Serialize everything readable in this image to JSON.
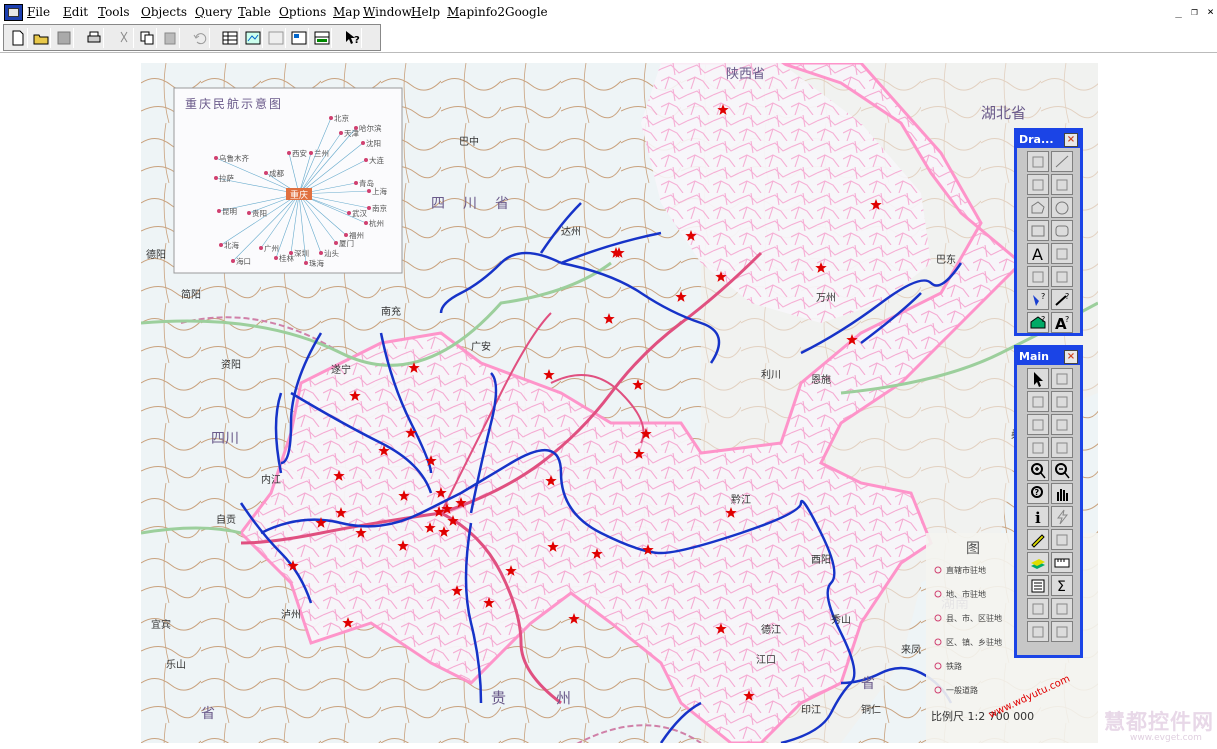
{
  "menu": {
    "items": [
      "File",
      "Edit",
      "Tools",
      "Objects",
      "Query",
      "Table",
      "Options",
      "Map",
      "Window",
      "Help",
      "Mapinfo2Google"
    ]
  },
  "window_controls": {
    "minimize": "_",
    "restore": "❐",
    "close": "×"
  },
  "toolbar": {
    "buttons": [
      "new-icon",
      "open-icon",
      "save-icon",
      "print-icon",
      "cut-icon",
      "copy-icon",
      "paste-icon",
      "undo-icon",
      "new-browser-icon",
      "new-mapper-icon",
      "new-grapher-icon",
      "new-layout-icon",
      "redistrict-icon",
      "help-pointer-icon"
    ]
  },
  "map": {
    "inset_title": "重庆民航示意图",
    "inset_hub": "重庆",
    "inset_cities": [
      "北京",
      "天津",
      "哈尔滨",
      "沈阳",
      "大连",
      "青岛",
      "上海",
      "南京",
      "武汉",
      "杭州",
      "福州",
      "厦门",
      "汕头",
      "深圳",
      "桂林",
      "珠海",
      "广州",
      "海口",
      "北海",
      "昆明",
      "贵阳",
      "成都",
      "西安",
      "乌鲁木齐",
      "拉萨",
      "兰州"
    ],
    "province_labels": [
      "陕西省",
      "四川省",
      "湖北省",
      "湖南",
      "贵州",
      "四川",
      "省",
      "省"
    ],
    "city_labels": [
      "巴中",
      "达州",
      "万州",
      "南充",
      "广安",
      "遂宁",
      "内江",
      "自贡",
      "宜宾",
      "泸州",
      "恩施",
      "黔江",
      "秀山",
      "酉阳",
      "德阳",
      "简阳",
      "乐山",
      "资阳",
      "巴东",
      "利川",
      "来凤",
      "桑植",
      "江口",
      "铜仁",
      "印江",
      "德江"
    ],
    "legend_title": "图",
    "legend_items": [
      "直辖市驻地",
      "地、市驻地",
      "县、市、区驻地",
      "区、镇、乡驻地",
      "铁路",
      "一般道路"
    ],
    "scale_text": "比例尺 1:2 700 000",
    "watermark_text": "www.wdyutu.com",
    "colors": {
      "rivers": "#1633c8",
      "roads": "#f07ab4",
      "stars": "#e00000",
      "boundary": "#ff9ecf",
      "highways": "#a0d0a0"
    }
  },
  "palettes": {
    "drawing": {
      "title": "Dra...",
      "close": "×",
      "tools": [
        "symbol-icon",
        "line-icon",
        "polyline-icon",
        "arc-icon",
        "polygon-icon",
        "ellipse-icon",
        "rectangle-icon",
        "rounded-rect-icon",
        "text-icon",
        "frame-icon",
        "reshape-icon",
        "add-node-icon",
        "symbol-style-icon",
        "line-style-icon",
        "region-style-icon",
        "text-style-icon"
      ]
    },
    "main": {
      "title": "Main",
      "close": "×",
      "tools": [
        "select-icon",
        "marquee-select-icon",
        "radius-select-icon",
        "polygon-select-icon",
        "boundary-select-icon",
        "unselect-all-icon",
        "graph-select-icon",
        "browse-select-icon",
        "zoom-in-icon",
        "zoom-out-icon",
        "change-view-icon",
        "grabber-icon",
        "info-icon",
        "hotlink-icon",
        "label-icon",
        "drag-window-icon",
        "layer-control-icon",
        "ruler-icon",
        "legend-icon",
        "statistics-icon",
        "clip-region-icon",
        "set-target-icon",
        "show-legend-icon",
        "show-statistics-icon"
      ]
    }
  },
  "watermark": {
    "site_cn": "慧都控件网",
    "site_url": "www.evget.com"
  }
}
